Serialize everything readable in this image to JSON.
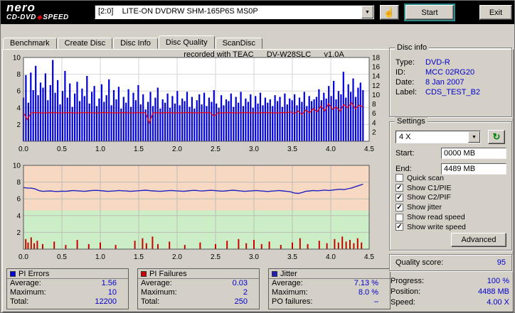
{
  "logo": {
    "brand": "nero",
    "product_left": "CD-DVD",
    "product_right": "SPEED"
  },
  "icons": {
    "arrow_down": "▼",
    "check": "✓",
    "refresh": "↻",
    "hand": "☝",
    "diamond": "◆"
  },
  "toolbar": {
    "drive": "[2:0]    LITE-ON DVDRW SHM-165P6S MS0P",
    "start_label": "Start",
    "exit_label": "Exit"
  },
  "tabs": {
    "items": [
      "Benchmark",
      "Create Disc",
      "Disc Info",
      "Disc Quality",
      "ScanDisc"
    ],
    "active": "Disc Quality"
  },
  "chart_header": "recorded with TEAC      DV-W28SLC      v1.0A",
  "chart_data": [
    {
      "type": "bar",
      "title": "PI Errors vs position (GB) with write speed curve",
      "x_max": 4.5,
      "x_ticks": [
        "0.0",
        "0.5",
        "1.0",
        "1.5",
        "2.0",
        "2.5",
        "3.0",
        "3.5",
        "4.0",
        "4.5"
      ],
      "left_max": 10,
      "left_ticks": [
        2,
        4,
        6,
        8,
        10
      ],
      "right_max": 18,
      "right_ticks": [
        2,
        4,
        6,
        8,
        10,
        12,
        14,
        16,
        18
      ],
      "bars_name": "PI Errors",
      "bars_color": "#0000dd",
      "line_name": "Write speed",
      "line_color": "#ee0000",
      "pi_bars": [
        5.2,
        7.9,
        4.6,
        8.2,
        6.1,
        9.0,
        5.5,
        7.0,
        6.4,
        8.1,
        4.9,
        6.7,
        9.7,
        5.8,
        7.3,
        4.4,
        6.0,
        8.4,
        5.2,
        6.9,
        4.1,
        5.7,
        7.1,
        4.8,
        6.3,
        5.4,
        7.8,
        4.5,
        5.9,
        6.6,
        4.2,
        5.1,
        6.8,
        4.7,
        5.5,
        7.4,
        4.3,
        6.1,
        5.0,
        6.5,
        3.9,
        5.3,
        4.6,
        6.2,
        4.1,
        5.8,
        4.9,
        6.7,
        4.4,
        5.6,
        3.8,
        4.7,
        5.9,
        4.2,
        5.2,
        6.4,
        3.9,
        5.0,
        4.6,
        5.7,
        4.0,
        5.4,
        4.5,
        6.0,
        4.3,
        5.1,
        4.8,
        5.9,
        4.1,
        5.3,
        3.9,
        4.9,
        5.6,
        4.4,
        5.8,
        4.2,
        5.2,
        4.7,
        6.1,
        4.5,
        4.0,
        5.5,
        4.3,
        5.0,
        4.8,
        5.7,
        4.1,
        5.3,
        4.6,
        5.9,
        4.2,
        5.1,
        4.7,
        5.6,
        4.0,
        5.4,
        4.5,
        5.8,
        4.3,
        5.2,
        4.6,
        5.0,
        4.2,
        5.5,
        4.8,
        5.3,
        4.1,
        5.7,
        4.4,
        5.1,
        4.9,
        5.6,
        4.3,
        5.2,
        4.7,
        5.9,
        4.2,
        5.4,
        4.8,
        5.0,
        5.3,
        6.2,
        4.9,
        5.8,
        5.1,
        6.6,
        5.4,
        7.2,
        5.0,
        6.0,
        5.6,
        8.3,
        5.2,
        6.8,
        5.9,
        7.5,
        5.3,
        6.4,
        7.0,
        6.1
      ],
      "speed_line": [
        3.4,
        2.6,
        3.4,
        3.42,
        3.4,
        3.38,
        3.4,
        3.42,
        3.4,
        3.4,
        3.38,
        3.4,
        3.42,
        3.4,
        3.38,
        3.4,
        3.4,
        3.42,
        3.4,
        3.38,
        3.4,
        3.42,
        3.4,
        3.4,
        3.38,
        3.4,
        3.42,
        3.4,
        3.38,
        3.4,
        3.4,
        3.42,
        3.4,
        2.2,
        3.4,
        3.4,
        3.38,
        3.4,
        3.42,
        3.4,
        3.38,
        3.4,
        3.4,
        3.42,
        3.4,
        3.38,
        3.4,
        3.42,
        3.4,
        3.4,
        3.0,
        3.4,
        3.38,
        3.4,
        3.42,
        3.4,
        3.38,
        3.4,
        3.4,
        3.42,
        3.4,
        3.38,
        3.4,
        3.42,
        3.4,
        3.4,
        3.38,
        3.4,
        3.42,
        3.4,
        3.5,
        3.3,
        3.6,
        3.2,
        3.7,
        3.4,
        3.9,
        3.5,
        4.2,
        3.6,
        4.5,
        3.8,
        4.1,
        3.6,
        4.4,
        4.0,
        4.6,
        3.9,
        4.3,
        4.1
      ]
    },
    {
      "type": "line",
      "title": "Jitter (%) vs position (GB) with PI Failures spikes",
      "x_max": 4.5,
      "x_ticks": [
        "0.0",
        "0.5",
        "1.0",
        "1.5",
        "2.0",
        "2.5",
        "3.0",
        "3.5",
        "4.0",
        "4.5"
      ],
      "left_max": 10,
      "left_ticks": [
        2,
        4,
        6,
        8,
        10
      ],
      "bands": [
        {
          "from": 4.6,
          "to": 10,
          "color": "#f7d9c3"
        },
        {
          "from": 0,
          "to": 4.6,
          "color": "#cbeec6"
        }
      ],
      "line_name": "Jitter",
      "line_color": "#2020c0",
      "spikes_name": "PI Failures",
      "spikes_color": "#cc0000",
      "jitter_line": [
        7.35,
        7.3,
        7.28,
        7.2,
        7.0,
        6.9,
        6.92,
        6.95,
        6.9,
        6.88,
        6.92,
        6.9,
        6.95,
        7.0,
        6.97,
        6.93,
        6.9,
        6.95,
        7.0,
        7.02,
        6.98,
        6.95,
        6.9,
        6.92,
        6.96,
        7.0,
        6.97,
        6.94,
        6.9,
        6.93,
        6.97,
        7.0,
        7.03,
        6.98,
        6.95,
        6.92,
        6.9,
        6.94,
        6.98,
        7.0,
        6.96,
        6.93,
        6.9,
        6.95,
        7.0,
        7.02,
        6.97,
        6.94,
        6.98,
        7.02,
        7.0,
        6.96,
        6.92,
        6.95,
        7.0,
        7.03,
        6.98,
        6.94,
        6.9,
        6.93,
        6.97,
        7.0,
        6.96,
        6.92,
        6.88,
        6.92,
        6.96,
        7.0,
        6.95,
        6.9,
        6.85,
        6.7,
        6.65,
        6.75,
        6.9,
        6.95,
        7.0,
        6.97,
        7.0,
        7.05,
        7.0,
        7.05,
        7.1,
        7.15,
        7.1,
        7.2,
        7.3,
        7.45,
        7.6,
        7.75
      ],
      "pif_spikes": [
        [
          0.03,
          1.2
        ],
        [
          0.06,
          0.8
        ],
        [
          0.1,
          1.4
        ],
        [
          0.14,
          0.7
        ],
        [
          0.18,
          1.0
        ],
        [
          0.25,
          0.6
        ],
        [
          0.4,
          0.9
        ],
        [
          0.55,
          0.5
        ],
        [
          0.7,
          1.1
        ],
        [
          0.85,
          0.6
        ],
        [
          1.0,
          0.8
        ],
        [
          1.2,
          0.5
        ],
        [
          1.45,
          1.0
        ],
        [
          1.55,
          1.3
        ],
        [
          1.6,
          0.7
        ],
        [
          1.68,
          1.5
        ],
        [
          1.75,
          0.6
        ],
        [
          1.9,
          0.9
        ],
        [
          2.1,
          0.5
        ],
        [
          2.3,
          0.8
        ],
        [
          2.5,
          0.6
        ],
        [
          2.65,
          1.0
        ],
        [
          2.8,
          1.2
        ],
        [
          2.9,
          0.7
        ],
        [
          3.0,
          1.1
        ],
        [
          3.1,
          0.6
        ],
        [
          3.2,
          0.9
        ],
        [
          3.35,
          0.5
        ],
        [
          3.5,
          0.8
        ],
        [
          3.6,
          1.3
        ],
        [
          3.7,
          0.6
        ],
        [
          3.85,
          1.0
        ],
        [
          3.95,
          0.7
        ],
        [
          4.05,
          1.2
        ],
        [
          4.1,
          0.8
        ],
        [
          4.15,
          1.5
        ],
        [
          4.2,
          0.9
        ],
        [
          4.25,
          1.1
        ],
        [
          4.3,
          0.7
        ],
        [
          4.35,
          1.3
        ],
        [
          4.4,
          0.8
        ]
      ]
    }
  ],
  "disc_info": {
    "title": "Disc info",
    "rows": [
      {
        "label": "Type:",
        "value": "DVD-R"
      },
      {
        "label": "ID:",
        "value": "MCC 02RG20"
      },
      {
        "label": "Date:",
        "value": "8 Jan 2007"
      },
      {
        "label": "Label:",
        "value": "CDS_TEST_B2"
      }
    ]
  },
  "settings": {
    "title": "Settings",
    "speed_value": "4 X",
    "start_label": "Start:",
    "start_value": "0000 MB",
    "end_label": "End:",
    "end_value": "4489 MB",
    "checkboxes": [
      {
        "label": "Quick scan",
        "checked": false
      },
      {
        "label": "Show C1/PIE",
        "checked": true
      },
      {
        "label": "Show C2/PIF",
        "checked": true
      },
      {
        "label": "Show jitter",
        "checked": true
      },
      {
        "label": "Show read speed",
        "checked": false
      },
      {
        "label": "Show write speed",
        "checked": true
      }
    ],
    "advanced_label": "Advanced"
  },
  "quality": {
    "label": "Quality score:",
    "value": "95"
  },
  "progress": {
    "rows": [
      {
        "label": "Progress:",
        "value": "100 %"
      },
      {
        "label": "Position:",
        "value": "4488 MB"
      },
      {
        "label": "Speed:",
        "value": "4.00 X"
      }
    ]
  },
  "stats": {
    "boxes": [
      {
        "title": "PI Errors",
        "color": "#0000dd",
        "rows": [
          {
            "label": "Average:",
            "value": "1.56"
          },
          {
            "label": "Maximum:",
            "value": "10"
          },
          {
            "label": "Total:",
            "value": "12200"
          }
        ]
      },
      {
        "title": "PI Failures",
        "color": "#cc0000",
        "rows": [
          {
            "label": "Average:",
            "value": "0.03"
          },
          {
            "label": "Maximum:",
            "value": "2"
          },
          {
            "label": "Total:",
            "value": "250"
          }
        ]
      },
      {
        "title": "Jitter",
        "color": "#2020c0",
        "rows": [
          {
            "label": "Average:",
            "value": "7.13 %"
          },
          {
            "label": "Maximum:",
            "value": "8.0 %"
          },
          {
            "label": "PO failures:",
            "value": "–"
          }
        ]
      }
    ]
  }
}
